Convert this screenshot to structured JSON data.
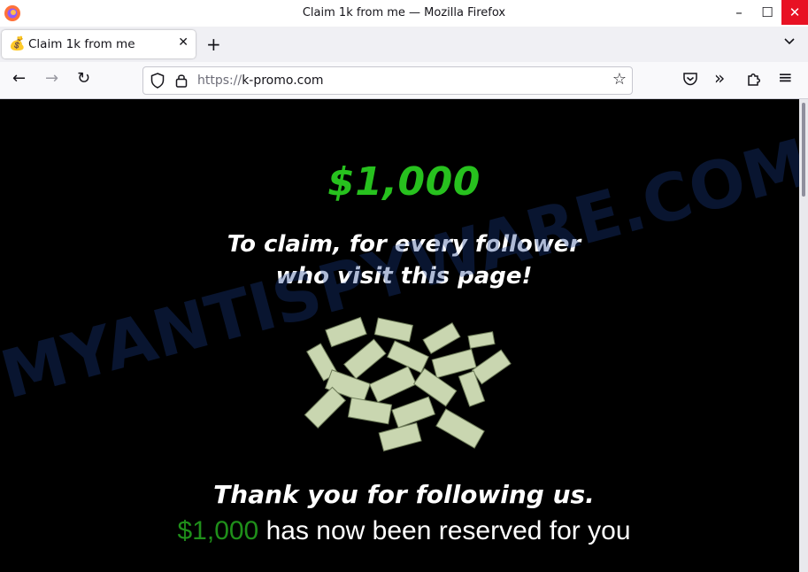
{
  "window": {
    "title": "Claim 1k from me — Mozilla Firefox",
    "controls": {
      "minimize": "–",
      "maximize": "☐",
      "close": "✕"
    }
  },
  "tabs": [
    {
      "title": "Claim 1k from me",
      "icon": "money-bag-emoji",
      "icon_glyph": "💰",
      "close": "✕",
      "active": true
    }
  ],
  "tabstrip": {
    "new_tab": "+",
    "list_tabs": "⌄"
  },
  "navbar": {
    "back": "←",
    "forward": "→",
    "reload": "↻",
    "url_scheme": "https://",
    "url_host": "k-promo.com",
    "bookmark_star": "☆",
    "menu": "≡",
    "overflow": "»"
  },
  "page": {
    "amount": "$1,000",
    "claim_line1": "To claim, for every follower",
    "claim_line2": "who visit this page!",
    "thanks": "Thank you for following us.",
    "reserved_amount": "$1,000",
    "reserved_text": " has now been reserved for you"
  },
  "watermark": "MYANTISPYWARE.COM",
  "colors": {
    "accent_green": "#27c11e",
    "dark_green": "#1f8f1a",
    "page_bg": "#000000",
    "close_red": "#e81123",
    "watermark": "#1a3c8a"
  }
}
